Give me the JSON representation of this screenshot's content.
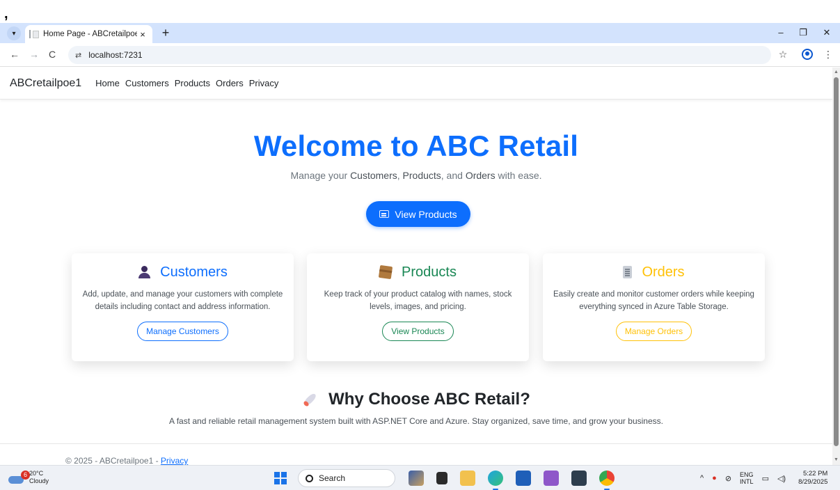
{
  "stray_mark": ",",
  "browser": {
    "tab_title": "Home Page - ABCretailpoe1",
    "tab_close": "×",
    "new_tab": "+",
    "url": "localhost:7231",
    "site_info_glyph": "⇄",
    "win_minimize": "–",
    "win_restore": "❐",
    "win_close": "✕",
    "back": "←",
    "forward": "→",
    "reload": "C",
    "star": "☆",
    "menu": "⋮",
    "tab_menu": "▾"
  },
  "nav": {
    "brand": "ABCretailpoe1",
    "links": [
      "Home",
      "Customers",
      "Products",
      "Orders",
      "Privacy"
    ]
  },
  "hero": {
    "title": "Welcome to ABC Retail",
    "subtitle_prefix": "Manage your ",
    "subtitle_customers": "Customers",
    "subtitle_sep1": ", ",
    "subtitle_products": "Products",
    "subtitle_sep2": ", and ",
    "subtitle_orders": "Orders",
    "subtitle_suffix": " with ease.",
    "cta_label": "View Products"
  },
  "cards": [
    {
      "title": "Customers",
      "icon": "person-icon",
      "text": "Add, update, and manage your customers with complete details including contact and address information.",
      "button": "Manage Customers",
      "color": "#0d6efd"
    },
    {
      "title": "Products",
      "icon": "package-icon",
      "text": "Keep track of your product catalog with names, stock levels, images, and pricing.",
      "button": "View Products",
      "color": "#198754"
    },
    {
      "title": "Orders",
      "icon": "document-icon",
      "text": "Easily create and monitor customer orders while keeping everything synced in Azure Table Storage.",
      "button": "Manage Orders",
      "color": "#ffc107"
    }
  ],
  "why": {
    "title": "Why Choose ABC Retail?",
    "text": "A fast and reliable retail management system built with ASP.NET Core and Azure. Stay organized, save time, and grow your business."
  },
  "footer": {
    "prefix": "© 2025 - ABCretailpoe1 - ",
    "privacy": "Privacy"
  },
  "taskbar": {
    "weather_badge": "6",
    "temp": "20°C",
    "condition": "Cloudy",
    "search_label": "Search",
    "lang_top": "ENG",
    "lang_bottom": "INTL",
    "time": "5:22 PM",
    "date": "8/29/2025",
    "tray_chevron": "^"
  },
  "colors": {
    "primary": "#0d6efd",
    "success": "#198754",
    "warning": "#ffc107"
  }
}
